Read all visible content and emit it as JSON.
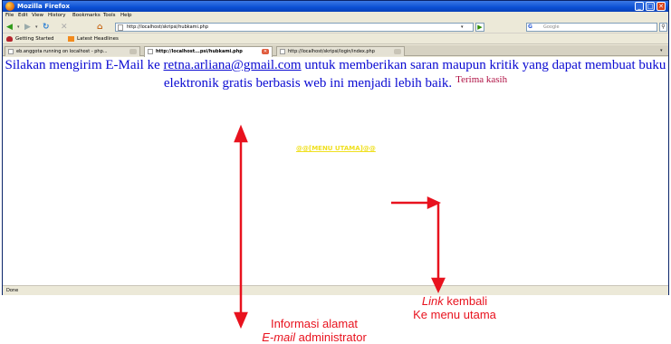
{
  "window": {
    "title": "Mozilla Firefox",
    "controls": {
      "minimize": "_",
      "maximize": "□",
      "close": "✕"
    }
  },
  "menu": [
    "File",
    "Edit",
    "View",
    "History",
    "Bookmarks",
    "Tools",
    "Help"
  ],
  "nav": {
    "url": "http://localhost/skripsi/hubkami.php",
    "search_placeholder": "Google",
    "search_engine": "G"
  },
  "bookmarks": [
    "Getting Started",
    "Latest Headlines"
  ],
  "tabs": [
    {
      "label": "eb.anggota running on localhost - php...",
      "active": false
    },
    {
      "label": "http://localhost...psi/hubkami.php",
      "active": true
    },
    {
      "label": "http://localhost/skripsi/login/index.php",
      "active": false
    }
  ],
  "page": {
    "message_before": "Silakan mengirim E-Mail ke ",
    "email": "retna.arliana@gmail.com",
    "message_after": " untuk memberikan saran maupun kritik yang dapat membuat buku elektronik gratis berbasis web ini menjadi lebih baik.",
    "thanks": "Terima kasih",
    "menu_link": "@@[MENU UTAMA]@@"
  },
  "status": "Done",
  "annotations": {
    "link_back": {
      "line1_italic": "Link",
      "line1_rest": " kembali",
      "line2": "Ke menu utama"
    },
    "email_info": {
      "line1": "Informasi alamat",
      "line2_italic": "E-mail",
      "line2_rest": " administrator"
    }
  },
  "colors": {
    "page_text": "#0a0ad2",
    "thanks_text": "#b01245",
    "menu_link": "#f0e020",
    "annotation": "#e8121e"
  }
}
